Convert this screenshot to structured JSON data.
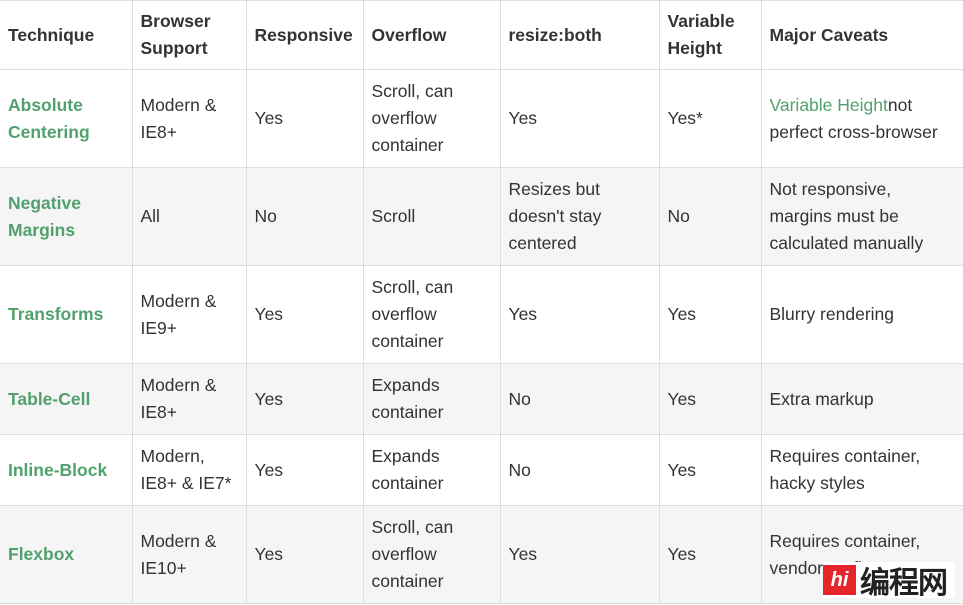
{
  "headers": [
    "Technique",
    "Browser Support",
    "Responsive",
    "Overflow",
    "resize:both",
    "Variable Height",
    "Major Caveats"
  ],
  "rows": [
    {
      "technique": "Absolute Centering",
      "support": "Modern & IE8+",
      "responsive": "Yes",
      "overflow": "Scroll, can overflow container",
      "resize": "Yes",
      "variable": "Yes*",
      "caveat_link": "Variable Height",
      "caveat": "not perfect cross-browser"
    },
    {
      "technique": "Negative Margins",
      "support": "All",
      "responsive": "No",
      "overflow": "Scroll",
      "resize": "Resizes but doesn't stay centered",
      "variable": "No",
      "caveat": "Not responsive, margins must be calculated manually"
    },
    {
      "technique": "Transforms",
      "support": "Modern & IE9+",
      "responsive": "Yes",
      "overflow": "Scroll, can overflow container",
      "resize": "Yes",
      "variable": "Yes",
      "caveat": "Blurry rendering"
    },
    {
      "technique": "Table-Cell",
      "support": "Modern & IE8+",
      "responsive": "Yes",
      "overflow": "Expands container",
      "resize": "No",
      "variable": "Yes",
      "caveat": "Extra markup"
    },
    {
      "technique": "Inline-Block",
      "support": "Modern, IE8+ & IE7*",
      "responsive": "Yes",
      "overflow": "Expands container",
      "resize": "No",
      "variable": "Yes",
      "caveat": "Requires container, hacky styles"
    },
    {
      "technique": "Flexbox",
      "support": "Modern & IE10+",
      "responsive": "Yes",
      "overflow": "Scroll, can overflow container",
      "resize": "Yes",
      "variable": "Yes",
      "caveat": "Requires container, vendor prefixes"
    }
  ],
  "watermark": {
    "logo": "hi",
    "text": "编程网"
  },
  "colors": {
    "link": "#52a06e",
    "text": "#333333",
    "stripe": "#f5f5f5",
    "border": "#dddddd"
  }
}
